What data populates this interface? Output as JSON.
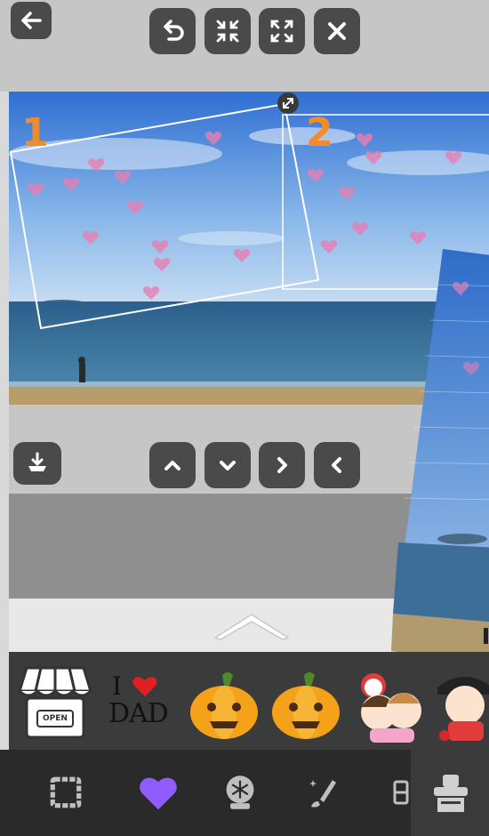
{
  "toolbar_top": {
    "back": "back-arrow-icon",
    "undo": "undo-icon",
    "shrink": "shrink-icon",
    "expand": "expand-icon",
    "close": "close-icon"
  },
  "photo": {
    "frame_labels": [
      "1",
      "2"
    ]
  },
  "toolbar_mid": {
    "save": "download-icon",
    "up": "chevron-up-icon",
    "down": "chevron-down-icon",
    "next": "chevron-right-icon",
    "prev": "chevron-left-icon"
  },
  "stickers": {
    "items": [
      {
        "name": "shop-sticker",
        "text": "OPEN"
      },
      {
        "name": "i-love-dad-sticker",
        "line1": "I",
        "line2": "DAD"
      },
      {
        "name": "pumpkin-sticker-1"
      },
      {
        "name": "pumpkin-sticker-2"
      },
      {
        "name": "girls-sticker"
      },
      {
        "name": "pirate-sticker"
      }
    ]
  },
  "bottom_tools": [
    "frame-icon",
    "heart-icon",
    "snowglobe-icon",
    "magic-brush-icon",
    "layout-icon",
    "stamp-icon"
  ],
  "colors": {
    "accent_heart": "#8f5cff",
    "label_orange": "#f28c28",
    "button_dark": "#4a4a4a"
  }
}
